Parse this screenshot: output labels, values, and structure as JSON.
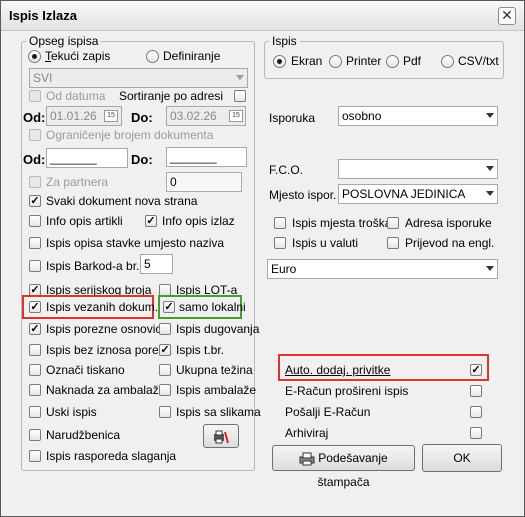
{
  "window": {
    "title": "Ispis Izlaza",
    "close_glyph": "✕"
  },
  "opseg": {
    "legend": "Opseg ispisa",
    "radio_tekuci": {
      "label": "Tekući zapis",
      "checked": true
    },
    "radio_definiranje": {
      "label": "Definiranje",
      "checked": false
    },
    "select_value": "SVI",
    "od_datuma": {
      "label": "Od datuma",
      "checked": false
    },
    "sortiranje": {
      "label": "Sortiranje po adresi",
      "checked": false
    },
    "od_label": "Od:",
    "do_label": "Do:",
    "date_from": "01.01.26",
    "date_to": "03.02.26",
    "cal_glyph": "15",
    "ogranicenje": {
      "label": "Ograničenje brojem dokumenta",
      "checked": false
    },
    "num_from": "_______",
    "num_to": "_______",
    "za_partnera": {
      "label": "Za partnera",
      "checked": false
    },
    "partner_value": "0"
  },
  "options": {
    "svaki_dokument": {
      "label": "Svaki dokument nova strana",
      "checked": true
    },
    "info_opis_artikli": {
      "label": "Info opis artikli",
      "checked": false
    },
    "info_opis_izlaz": {
      "label": "Info opis izlaz",
      "checked": true
    },
    "ispis_opisa_stavke": {
      "label": "Ispis opisa stavke umjesto naziva",
      "checked": false
    },
    "ispis_barkoda": {
      "label": "Ispis Barkod-a br. :",
      "checked": false
    },
    "barkod_value": "5",
    "ispis_serijskog": {
      "label": "Ispis serijskog broja",
      "checked": true
    },
    "ispis_lot": {
      "label": "Ispis LOT-a",
      "checked": false
    },
    "ispis_vezanih": {
      "label": "Ispis vezanih dokum.",
      "checked": true
    },
    "samo_lokalni": {
      "label": "samo lokalni",
      "checked": true
    },
    "ispis_porezne": {
      "label": "Ispis porezne osnovice",
      "checked": true
    },
    "ispis_dugovanja": {
      "label": "Ispis dugovanja",
      "checked": false
    },
    "ispis_bez_iznosa": {
      "label": "Ispis bez iznosa poreza",
      "checked": false
    },
    "ispis_tbr": {
      "label": "Ispis t.br.",
      "checked": true
    },
    "oznaci_tiskano": {
      "label": "Označi tiskano",
      "checked": false
    },
    "ukupna_tezina": {
      "label": "Ukupna težina",
      "checked": false
    },
    "naknada_ambalazu": {
      "label": "Naknada za ambalažu",
      "checked": false
    },
    "ispis_ambalaze": {
      "label": "Ispis ambalaže",
      "checked": false
    },
    "uski_ispis": {
      "label": "Uski ispis",
      "checked": false
    },
    "ispis_sa_slikama": {
      "label": "Ispis sa slikama",
      "checked": false
    },
    "narudzbenica": {
      "label": "Narudžbenica",
      "checked": false
    },
    "ispis_rasporeda": {
      "label": "Ispis rasporeda slaganja",
      "checked": false
    },
    "check_mark": "✓"
  },
  "ispis": {
    "legend": "Ispis",
    "ekran": {
      "label": "Ekran",
      "checked": true
    },
    "printer": {
      "label": "Printer",
      "checked": false
    },
    "pdf": {
      "label": "Pdf",
      "checked": false
    },
    "csv": {
      "label": "CSV/txt",
      "checked": false
    }
  },
  "right": {
    "isporuka_label": "Isporuka",
    "isporuka_value": "osobno",
    "fco_label": "F.C.O.",
    "fco_value": "",
    "mjesto_label": "Mjesto ispor.",
    "mjesto_value": "POSLOVNA JEDINICA",
    "ispis_mjesta": {
      "label": "Ispis mjesta troška",
      "checked": false
    },
    "adresa_isporuke": {
      "label": "Adresa isporuke",
      "checked": false
    },
    "ispis_u_valuti": {
      "label": "Ispis u valuti",
      "checked": false
    },
    "prijevod": {
      "label": "Prijevod na engl.",
      "checked": false
    },
    "valuta_value": "Euro",
    "auto_dodaj": {
      "label": "Auto. dodaj. privitke",
      "checked": true
    },
    "eracun_prosireni": {
      "label": "E-Račun prošireni ispis",
      "checked": false
    },
    "posalji_eracun": {
      "label": "Pošalji E-Račun",
      "checked": false
    },
    "arhiviraj": {
      "label": "Arhiviraj",
      "checked": false
    }
  },
  "buttons": {
    "podesavanje": "Podešavanje štampača",
    "ok": "OK"
  },
  "icons": {
    "tool_icon": "printer-settings-icon",
    "printer_icon": "printer-icon"
  },
  "colors": {
    "highlight_red": "#e0332d",
    "highlight_green": "#4a9d2a"
  }
}
